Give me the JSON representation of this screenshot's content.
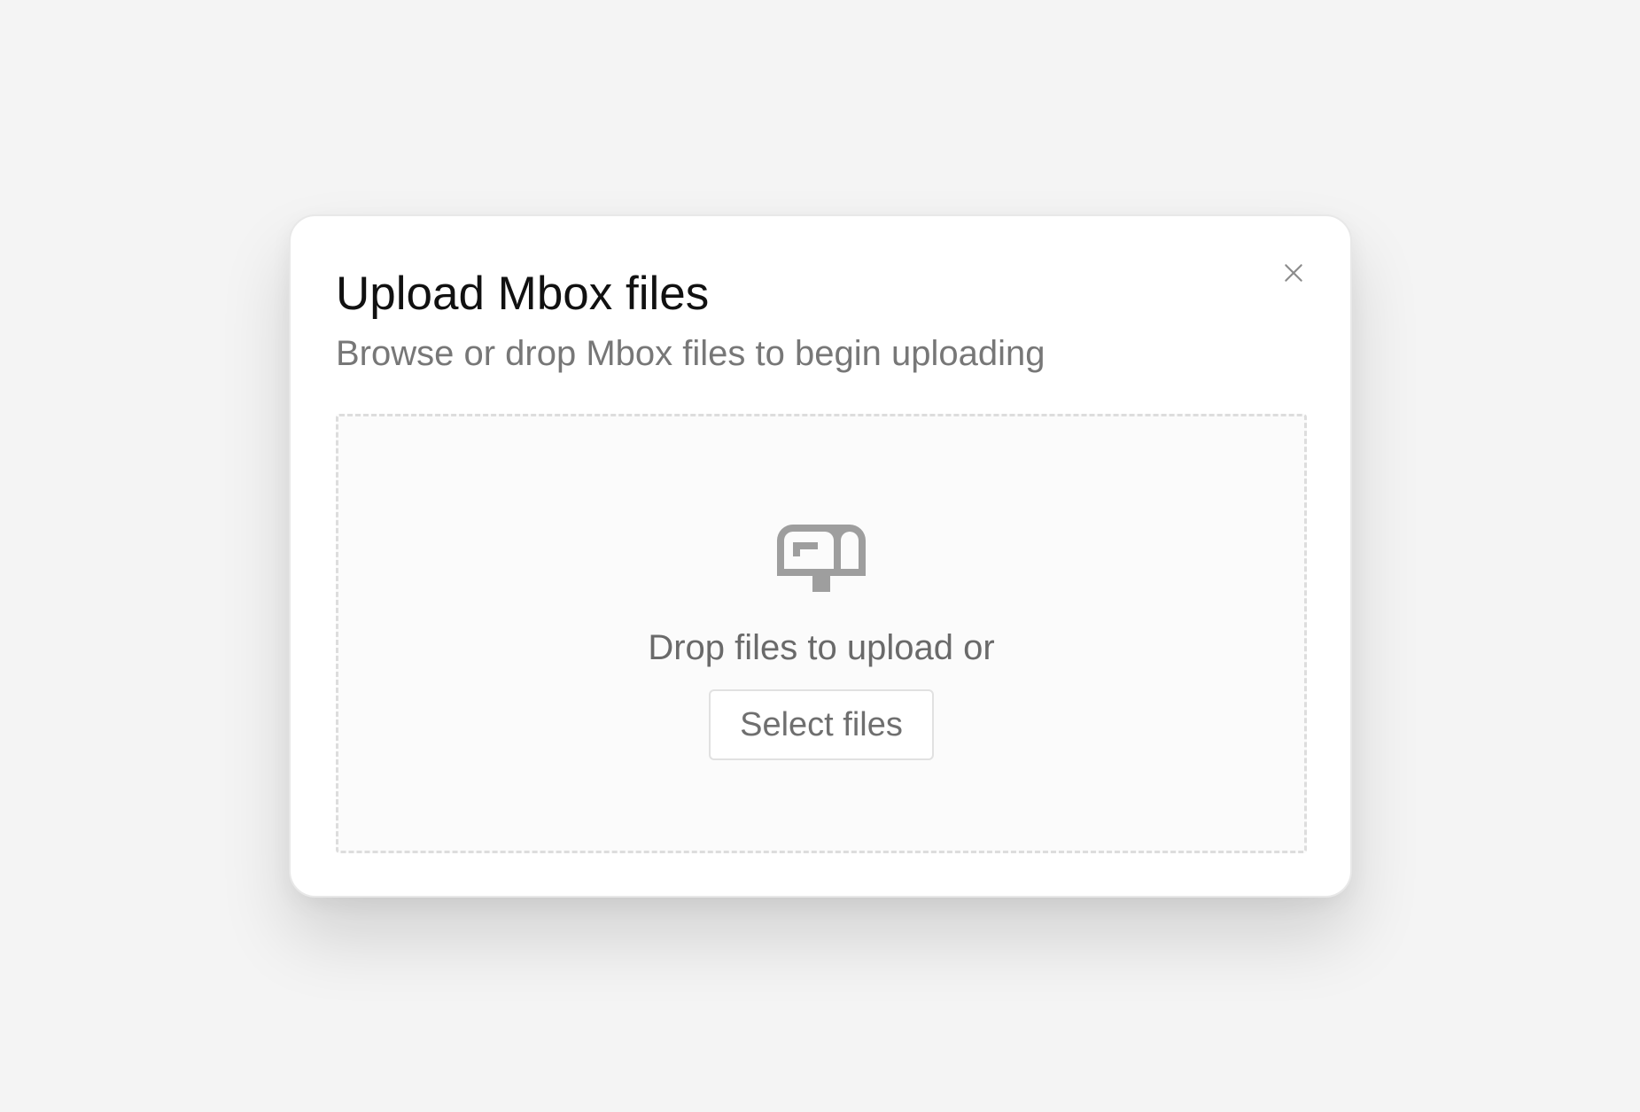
{
  "modal": {
    "title": "Upload Mbox files",
    "subtitle": "Browse or drop Mbox files to begin uploading",
    "close_icon": "close-icon"
  },
  "dropzone": {
    "icon": "mailbox-icon",
    "drop_text": "Drop files to upload or",
    "select_button_label": "Select files"
  },
  "colors": {
    "background": "#f4f4f4",
    "modal": "#ffffff",
    "title_text": "#111111",
    "muted_text": "#777777",
    "icon": "#9e9e9e",
    "dashed_border": "#dddddd"
  }
}
